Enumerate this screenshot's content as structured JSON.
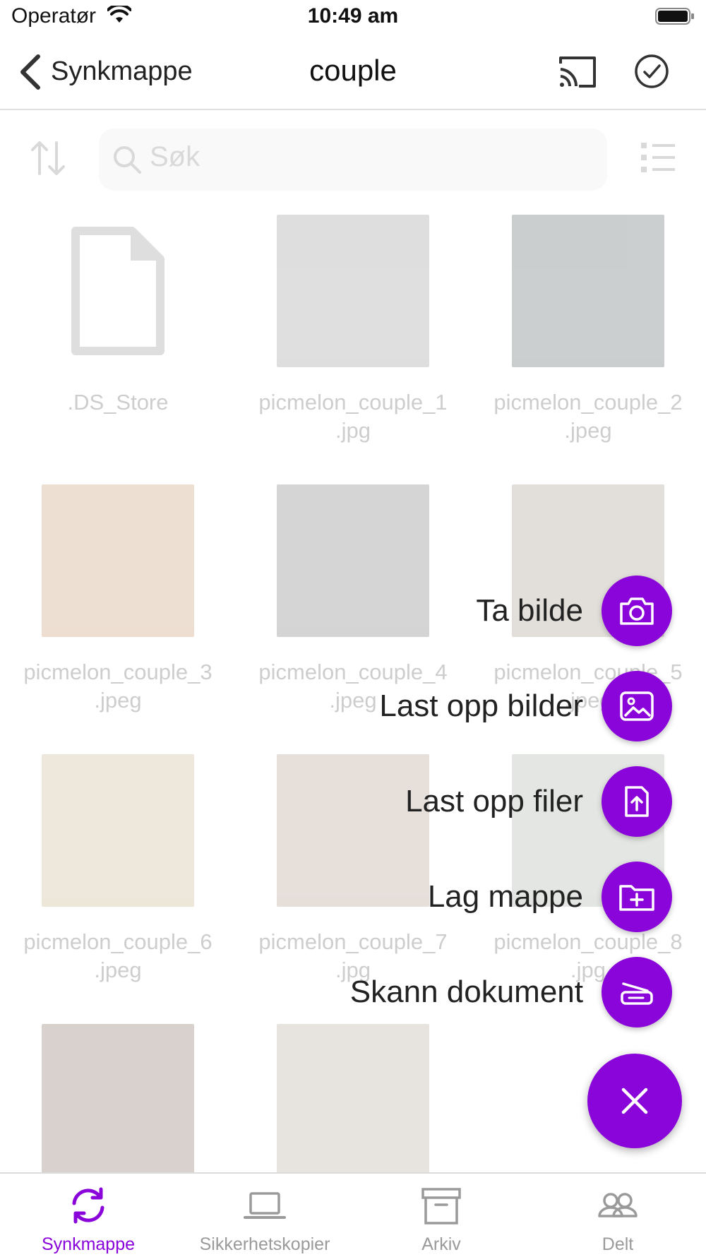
{
  "status_bar": {
    "carrier": "Operatør",
    "time": "10:49 am"
  },
  "nav": {
    "back_label": "Synkmappe",
    "title": "couple"
  },
  "search": {
    "placeholder": "Søk"
  },
  "files": [
    {
      "name": ".DS_Store",
      "line2": "",
      "kind": "document",
      "color": "#d9d9d9"
    },
    {
      "name": "picmelon_couple_1",
      "line2": ".jpg",
      "kind": "image",
      "color": "#9a9a9a"
    },
    {
      "name": "picmelon_couple_2",
      "line2": ".jpeg",
      "kind": "image",
      "color": "#5f6a6d"
    },
    {
      "name": "picmelon_couple_3",
      "line2": ".jpeg",
      "kind": "image",
      "color": "#c89a74"
    },
    {
      "name": "picmelon_couple_4",
      "line2": ".jpeg",
      "kind": "image",
      "color": "#7d7d7d"
    },
    {
      "name": "picmelon_couple_5",
      "line2": ".jpeg",
      "kind": "image",
      "color": "#a69a8e"
    },
    {
      "name": "picmelon_couple_6",
      "line2": ".jpeg",
      "kind": "image",
      "color": "#c8b68e"
    },
    {
      "name": "picmelon_couple_7",
      "line2": ".jpg",
      "kind": "image",
      "color": "#b09a8c"
    },
    {
      "name": "picmelon_couple_8",
      "line2": ".jpg",
      "kind": "image",
      "color": "#a7b0a8"
    },
    {
      "name": "",
      "line2": "",
      "kind": "image",
      "color": "#8a6f62"
    },
    {
      "name": "",
      "line2": "",
      "kind": "image",
      "color": "#b3aaa0"
    }
  ],
  "actions": [
    {
      "label": "Ta bilde",
      "icon": "camera-icon"
    },
    {
      "label": "Last opp bilder",
      "icon": "image-icon"
    },
    {
      "label": "Last opp filer",
      "icon": "file-upload-icon"
    },
    {
      "label": "Lag mappe",
      "icon": "folder-plus-icon"
    },
    {
      "label": "Skann dokument",
      "icon": "scanner-icon"
    }
  ],
  "fab": {
    "icon": "close-icon"
  },
  "tabs": [
    {
      "label": "Synkmappe",
      "icon": "sync-icon",
      "active": true
    },
    {
      "label": "Sikkerhetskopier",
      "icon": "laptop-icon",
      "active": false
    },
    {
      "label": "Arkiv",
      "icon": "archive-box-icon",
      "active": false
    },
    {
      "label": "Delt",
      "icon": "people-icon",
      "active": false
    }
  ],
  "colors": {
    "accent": "#8a05d9",
    "inactive_tab": "#9a9a9a"
  }
}
